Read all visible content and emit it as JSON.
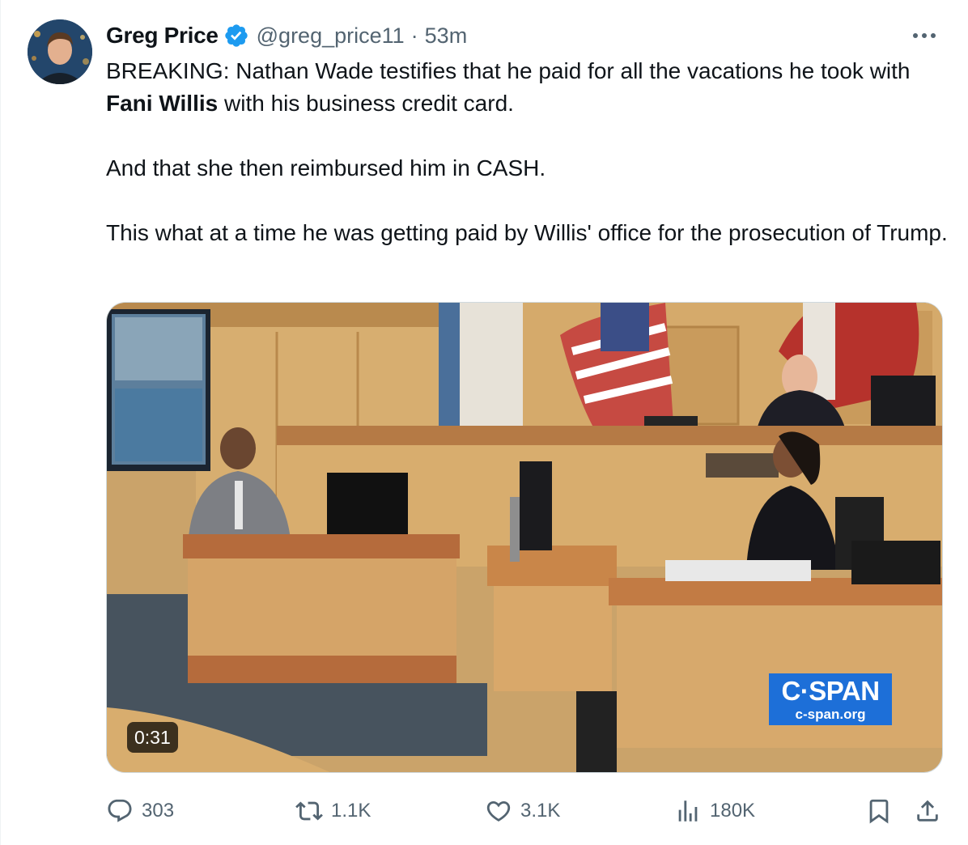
{
  "author": {
    "display_name": "Greg Price",
    "handle": "@greg_price11",
    "separator": "·",
    "time": "53m",
    "verified_icon": "verified-badge-icon",
    "verified_color": "#1d9bf0"
  },
  "tweet": {
    "paragraph1_before": "BREAKING: Nathan Wade testifies that he paid for all the vacations he took with ",
    "paragraph1_bold": "Fani Willis",
    "paragraph1_after": " with his business credit card.",
    "paragraph2": "And that she then reimbursed him in CASH.",
    "paragraph3": "This what at a time he was getting paid by Willis' office for the prosecution of Trump."
  },
  "media": {
    "type": "video",
    "duration": "0:31",
    "watermark_title": "C·SPAN",
    "watermark_url": "c-span.org",
    "watermark_color": "#1d6fd8"
  },
  "actions": {
    "replies": "303",
    "reposts": "1.1K",
    "likes": "3.1K",
    "views": "180K",
    "icon_color": "#536471"
  }
}
